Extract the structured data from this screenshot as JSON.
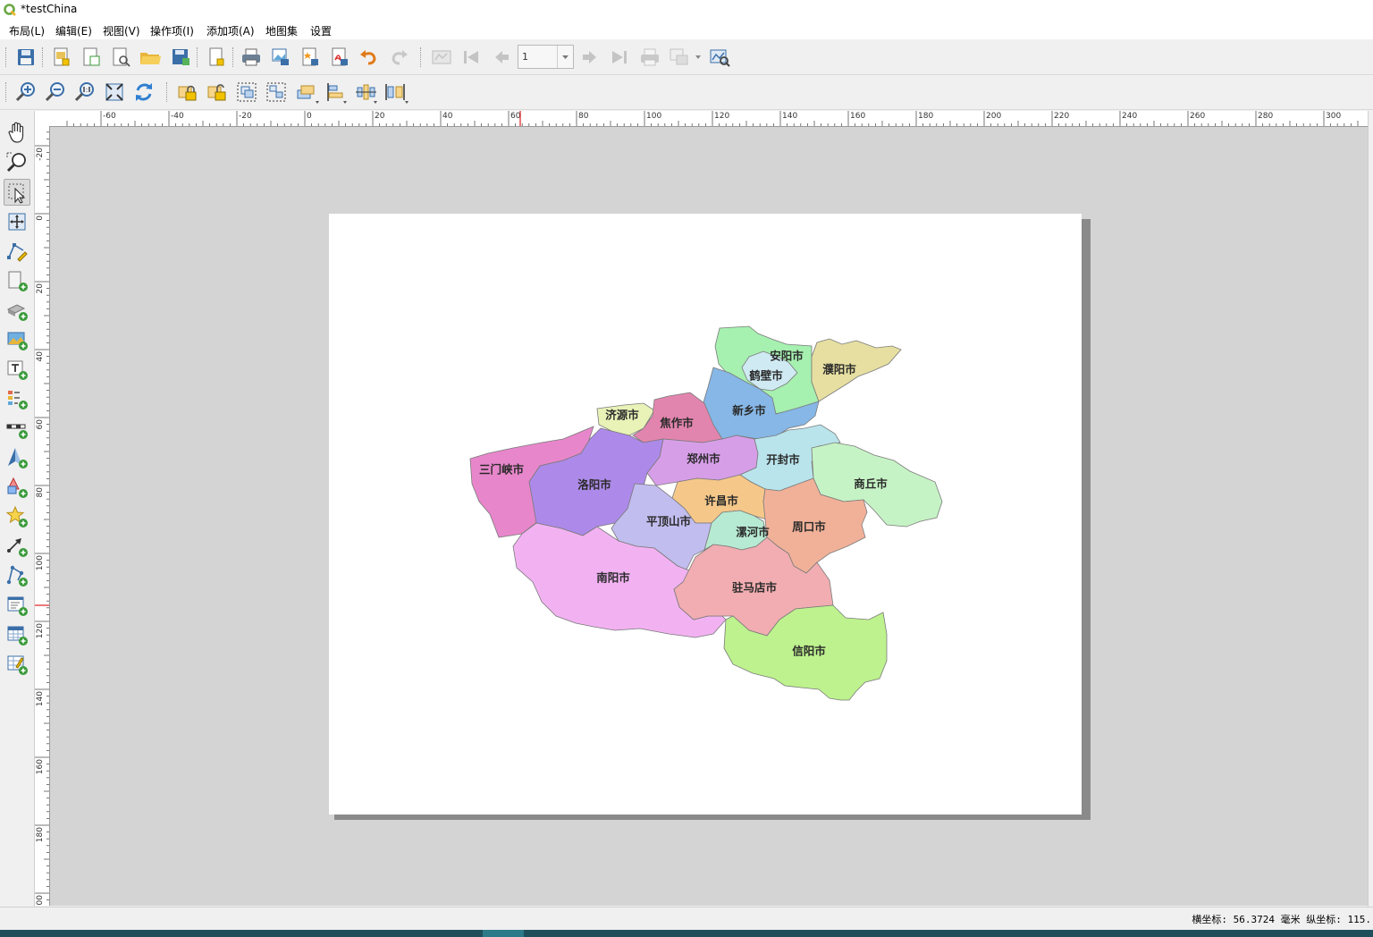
{
  "window": {
    "title": "*testChina"
  },
  "menu": [
    "布局(L)",
    "编辑(E)",
    "视图(V)",
    "操作项(I)",
    "添加项(A)",
    "地图集",
    "设置"
  ],
  "toolbar1": {
    "buttons": [
      "save-icon",
      "new-layout-icon",
      "duplicate-layout-icon",
      "layout-manager-icon",
      "open-template-icon",
      "save-template-icon",
      "page-setup-icon",
      "print-icon",
      "export-image-icon",
      "export-svg-icon",
      "export-pdf-icon",
      "undo-icon",
      "redo-icon",
      "atlas-preview-icon",
      "first-feature-icon",
      "previous-feature-icon",
      "next-feature-icon",
      "last-feature-icon",
      "atlas-print-icon",
      "atlas-export-icon",
      "atlas-settings-icon"
    ],
    "page_value": "1"
  },
  "toolbar2": {
    "buttons": [
      "zoom-in-icon",
      "zoom-out-icon",
      "zoom-actual-icon",
      "zoom-full-icon",
      "refresh-icon",
      "lock-items-icon",
      "unlock-items-icon",
      "group-icon",
      "ungroup-icon",
      "raise-icon",
      "align-icon",
      "distribute-icon",
      "resize-icon"
    ]
  },
  "lefttools": [
    "pan-icon",
    "zoom-tool-icon",
    "select-move-icon",
    "move-content-icon",
    "edit-nodes-icon",
    "add-map-icon",
    "add-3d-map-icon",
    "add-picture-icon",
    "add-label-icon",
    "add-legend-icon",
    "add-scalebar-icon",
    "add-north-arrow-icon",
    "add-shape-icon",
    "add-marker-icon",
    "add-arrow-icon",
    "add-node-item-icon",
    "add-html-icon",
    "add-attribute-table-icon",
    "add-fixed-table-icon"
  ],
  "ruler": {
    "h_labels": [
      "-60",
      "-40",
      "-20",
      "0",
      "20",
      "40",
      "60",
      "80",
      "100",
      "120",
      "140",
      "160",
      "180",
      "200",
      "220",
      "240",
      "260",
      "280",
      "300"
    ],
    "v_labels": [
      "-20",
      "0",
      "20",
      "40",
      "60",
      "80",
      "100",
      "120",
      "140",
      "160",
      "180",
      "200"
    ]
  },
  "map": {
    "regions": [
      {
        "name": "安阳市",
        "color": "#a6f0b0"
      },
      {
        "name": "鹤壁市",
        "color": "#cfeaf3"
      },
      {
        "name": "濮阳市",
        "color": "#e6dfa1"
      },
      {
        "name": "新乡市",
        "color": "#86b7e6"
      },
      {
        "name": "济源市",
        "color": "#e9f2b7"
      },
      {
        "name": "焦作市",
        "color": "#e285ae"
      },
      {
        "name": "三门峡市",
        "color": "#e886cb"
      },
      {
        "name": "洛阳市",
        "color": "#ad8ae9"
      },
      {
        "name": "郑州市",
        "color": "#d79ee8"
      },
      {
        "name": "开封市",
        "color": "#b9e4ec"
      },
      {
        "name": "商丘市",
        "color": "#c6f3c5"
      },
      {
        "name": "许昌市",
        "color": "#f5c88a"
      },
      {
        "name": "平顶山市",
        "color": "#c2bdef"
      },
      {
        "name": "漯河市",
        "color": "#b7ead3"
      },
      {
        "name": "周口市",
        "color": "#f1b199"
      },
      {
        "name": "南阳市",
        "color": "#f2b2f2"
      },
      {
        "name": "驻马店市",
        "color": "#f1adb1"
      },
      {
        "name": "信阳市",
        "color": "#bdf28e"
      }
    ]
  },
  "status": {
    "coords": "横坐标: 56.3724 毫米 纵坐标: 115."
  }
}
